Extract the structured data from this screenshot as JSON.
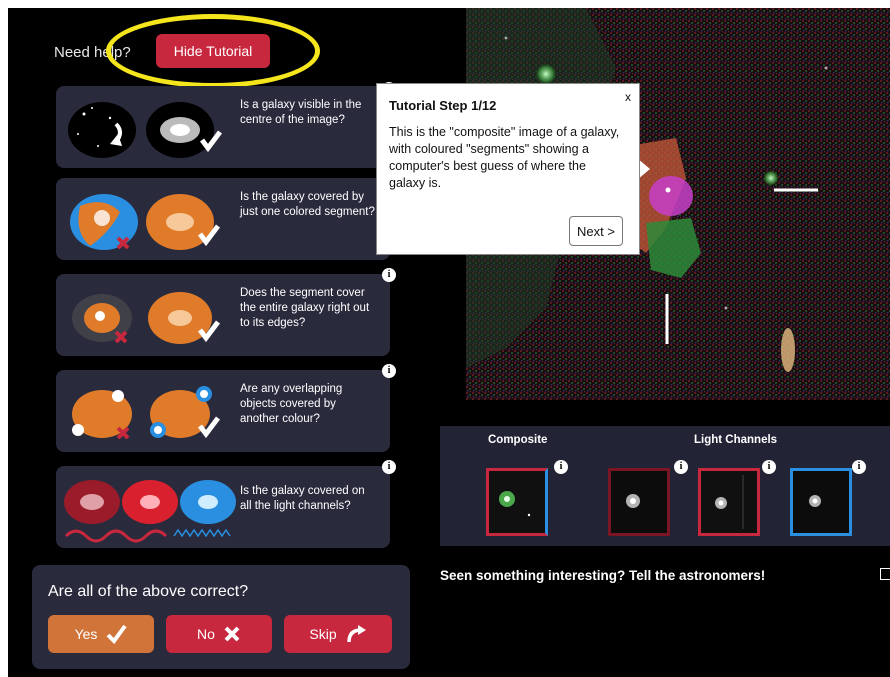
{
  "header": {
    "need_help": "Need help?",
    "hide_tutorial": "Hide Tutorial"
  },
  "questions": [
    {
      "text": "Is a galaxy visible in the centre of the image?",
      "has_info": true
    },
    {
      "text": "Is the galaxy covered by just one colored segment?",
      "has_info": false
    },
    {
      "text": "Does the segment cover the entire galaxy right out to its edges?",
      "has_info": true
    },
    {
      "text": "Are any overlapping objects covered by another colour?",
      "has_info": true
    },
    {
      "text": "Is the galaxy covered on all the light channels?",
      "has_info": true
    }
  ],
  "answer_panel": {
    "prompt": "Are all of the above correct?",
    "yes": "Yes",
    "no": "No",
    "skip": "Skip"
  },
  "tooltip": {
    "title": "Tutorial Step 1/12",
    "close": "x",
    "body": "This is the \"composite\" image of a galaxy, with coloured \"segments\" showing a computer's best guess of where the galaxy is.",
    "next": "Next >"
  },
  "channels": {
    "composite_label": "Composite",
    "light_label": "Light Channels"
  },
  "footer": {
    "seen": "Seen something interesting? Tell the astronomers!"
  },
  "colors": {
    "accent_red": "#c8283e",
    "yes_orange": "#d0743a",
    "panel": "#2a2a3d",
    "highlight_yellow": "#f4e51c",
    "channel_blue": "#2a8fe0"
  },
  "icons": [
    "info-icon",
    "checkmark-icon",
    "cross-icon",
    "skip-arrow-icon",
    "close-icon"
  ]
}
